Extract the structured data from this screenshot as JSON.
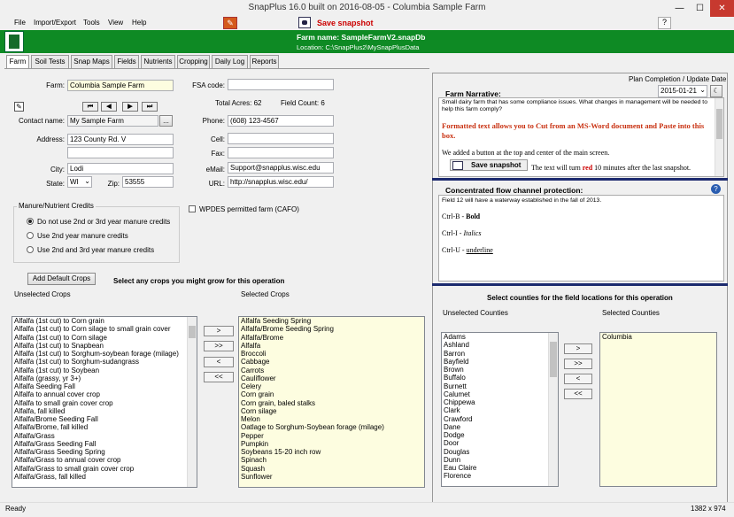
{
  "window": {
    "title": "SnapPlus 16.0 built on 2016-08-05 - Columbia Sample Farm",
    "minimize": "—",
    "maximize": "☐",
    "close": "✕"
  },
  "menu": [
    "File",
    "Import/Export",
    "Tools",
    "View",
    "Help"
  ],
  "toolbar": {
    "snapshot_label": "Save snapshot",
    "help": "?"
  },
  "header": {
    "farm_name": "Farm name: SampleFarmV2.snapDb",
    "location": "Location: C:\\SnapPlus2\\MySnapPlusData"
  },
  "tabs": [
    "Farm",
    "Soil Tests",
    "Snap Maps",
    "Fields",
    "Nutrients",
    "Cropping",
    "Daily Log",
    "Reports"
  ],
  "form": {
    "farm_label": "Farm:",
    "farm_value": "Columbia Sample Farm",
    "fsa_label": "FSA code:",
    "fsa_value": "",
    "total_acres": "Total Acres: 62",
    "field_count": "Field Count: 6",
    "nav": [
      "⏮",
      "◀",
      "▶",
      "⏭"
    ],
    "contact_label": "Contact name:",
    "contact_value": "My Sample Farm",
    "contact_btn": "...",
    "phone_label": "Phone:",
    "phone_value": "(608) 123-4567",
    "address_label": "Address:",
    "address1": "123 County Rd. V",
    "address2": "",
    "cell_label": "Cell:",
    "cell_value": "",
    "fax_label": "Fax:",
    "fax_value": "",
    "city_label": "City:",
    "city_value": "Lodi",
    "email_label": "eMail:",
    "email_value": "Support@snapplus.wisc.edu",
    "state_label": "State:",
    "state_value": "WI",
    "zip_label": "Zip:",
    "zip_value": "53555",
    "url_label": "URL:",
    "url_value": "http://snapplus.wisc.edu/"
  },
  "credits": {
    "title": "Manure/Nutrient Credits",
    "options": [
      "Do not use 2nd or 3rd year manure credits",
      "Use 2nd year manure credits",
      "Use 2nd and 3rd year manure credits"
    ],
    "selected": 0
  },
  "wpdes_label": "WPDES permitted farm (CAFO)",
  "crops": {
    "add_default": "Add Default Crops",
    "instruction": "Select any crops you might grow for this operation",
    "unselected_title": "Unselected Crops",
    "selected_title": "Selected Crops",
    "unselected": [
      "Alfalfa (1st cut) to Corn grain",
      "Alfalfa (1st cut) to Corn silage to small grain cover",
      "Alfalfa (1st cut) to Corn silage",
      "Alfalfa (1st cut) to Snapbean",
      "Alfalfa (1st cut) to Sorghum-soybean forage (milage)",
      "Alfalfa (1st cut) to Sorghum-sudangrass",
      "Alfalfa (1st cut) to Soybean",
      "Alfalfa (grassy, yr 3+)",
      "Alfalfa Seeding Fall",
      "Alfalfa to annual cover crop",
      "Alfalfa to small grain cover crop",
      "Alfalfa, fall killed",
      "Alfalfa/Brome Seeding Fall",
      "Alfalfa/Brome, fall killed",
      "Alfalfa/Grass",
      "Alfalfa/Grass Seeding Fall",
      "Alfalfa/Grass Seeding Spring",
      "Alfalfa/Grass to annual cover crop",
      "Alfalfa/Grass to small grain cover crop",
      "Alfalfa/Grass, fall killed"
    ],
    "selected": [
      "Alfalfa Seeding Spring",
      "Alfalfa/Brome Seeding Spring",
      "Alfalfa/Brome",
      "Alfalfa",
      "Broccoli",
      "Cabbage",
      "Carrots",
      "Cauliflower",
      "Celery",
      "Corn grain",
      "Corn grain, baled stalks",
      "Corn silage",
      "Melon",
      "Oatlage to Sorghum-Soybean forage (milage)",
      "Pepper",
      "Pumpkin",
      "Soybeans 15-20 inch row",
      "Spinach",
      "Squash",
      "Sunflower"
    ],
    "buttons": [
      ">",
      ">>",
      "<",
      "<<"
    ]
  },
  "narrative": {
    "plan_label": "Plan Completion / Update Date",
    "date": "2015-01-21",
    "title": "Farm Narrative:",
    "line1": "Small dairy farm that has some compliance issues.  What changes in management will be needed to help this farm comply?",
    "line2": "Formatted text allows you to Cut from an MS-Word document and Paste into this box.",
    "line3": "We added a button at the top and center of the main screen.",
    "snapshot_btn": "Save snapshot",
    "line4a": "The text will turn ",
    "line4b": "red",
    "line4c": " 10 minutes after the last snapshot."
  },
  "concentrated": {
    "title": "Concentrated flow channel protection:",
    "line1": "Field 12 will have a waterway established in the fall of 2013.",
    "bold_prefix": "Ctrl-B - ",
    "bold": "Bold",
    "italic_prefix": "Ctrl-I - ",
    "italic": "Italics",
    "underline_prefix": "Ctrl-U - ",
    "underline": "underline"
  },
  "counties": {
    "instruction": "Select counties for the field locations for this operation",
    "unselected_title": "Unselected Counties",
    "selected_title": "Selected Counties",
    "unselected": [
      "Adams",
      "Ashland",
      "Barron",
      "Bayfield",
      "Brown",
      "Buffalo",
      "Burnett",
      "Calumet",
      "Chippewa",
      "Clark",
      "Crawford",
      "Dane",
      "Dodge",
      "Door",
      "Douglas",
      "Dunn",
      "Eau Claire",
      "Florence"
    ],
    "selected": [
      "Columbia"
    ],
    "buttons": [
      ">",
      ">>",
      "<",
      "<<"
    ]
  },
  "status": {
    "text": "Ready",
    "resolution": "1382 x 974"
  }
}
